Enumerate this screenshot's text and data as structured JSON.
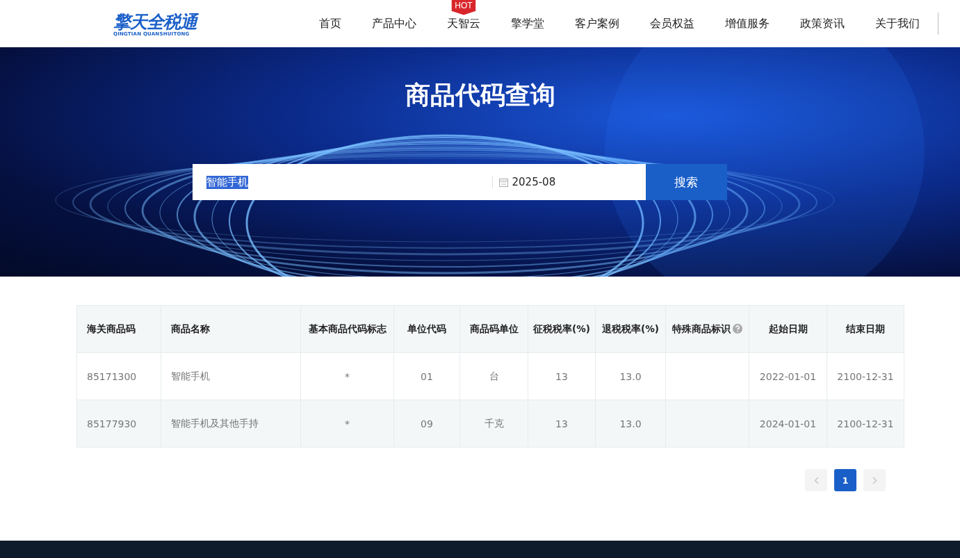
{
  "header": {
    "logo": {
      "name": "擎天全税通",
      "subtitle": "QINGTIAN QUANSHUITONG"
    },
    "nav": [
      {
        "label": "首页"
      },
      {
        "label": "产品中心"
      },
      {
        "label": "天智云",
        "badge": "HOT"
      },
      {
        "label": "擎学堂"
      },
      {
        "label": "客户案例"
      },
      {
        "label": "会员权益"
      },
      {
        "label": "增值服务"
      },
      {
        "label": "政策资讯"
      },
      {
        "label": "关于我们"
      }
    ]
  },
  "banner": {
    "title": "商品代码查询",
    "search": {
      "value": "智能手机",
      "value_selected": true
    },
    "date": {
      "value": "2025-08"
    },
    "search_button": "搜索"
  },
  "table": {
    "columns": [
      {
        "label": "海关商品码",
        "help": false
      },
      {
        "label": "商品名称",
        "help": false
      },
      {
        "label": "基本商品代码标志",
        "help": false
      },
      {
        "label": "单位代码",
        "help": false
      },
      {
        "label": "商品码单位",
        "help": false
      },
      {
        "label": "征税税率(%)",
        "help": false
      },
      {
        "label": "退税税率(%)",
        "help": false
      },
      {
        "label": "特殊商品标识",
        "help": true
      },
      {
        "label": "起始日期",
        "help": false
      },
      {
        "label": "结束日期",
        "help": false
      }
    ],
    "rows": [
      [
        "85171300",
        "智能手机",
        "*",
        "01",
        "台",
        "13",
        "13.0",
        "",
        "2022-01-01",
        "2100-12-31"
      ],
      [
        "85177930",
        "智能手机及其他手持",
        "*",
        "09",
        "千克",
        "13",
        "13.0",
        "",
        "2024-01-01",
        "2100-12-31"
      ]
    ]
  },
  "pagination": {
    "prev_disabled": true,
    "pages": [
      {
        "label": "1",
        "selected": true
      }
    ],
    "next_disabled": true
  }
}
